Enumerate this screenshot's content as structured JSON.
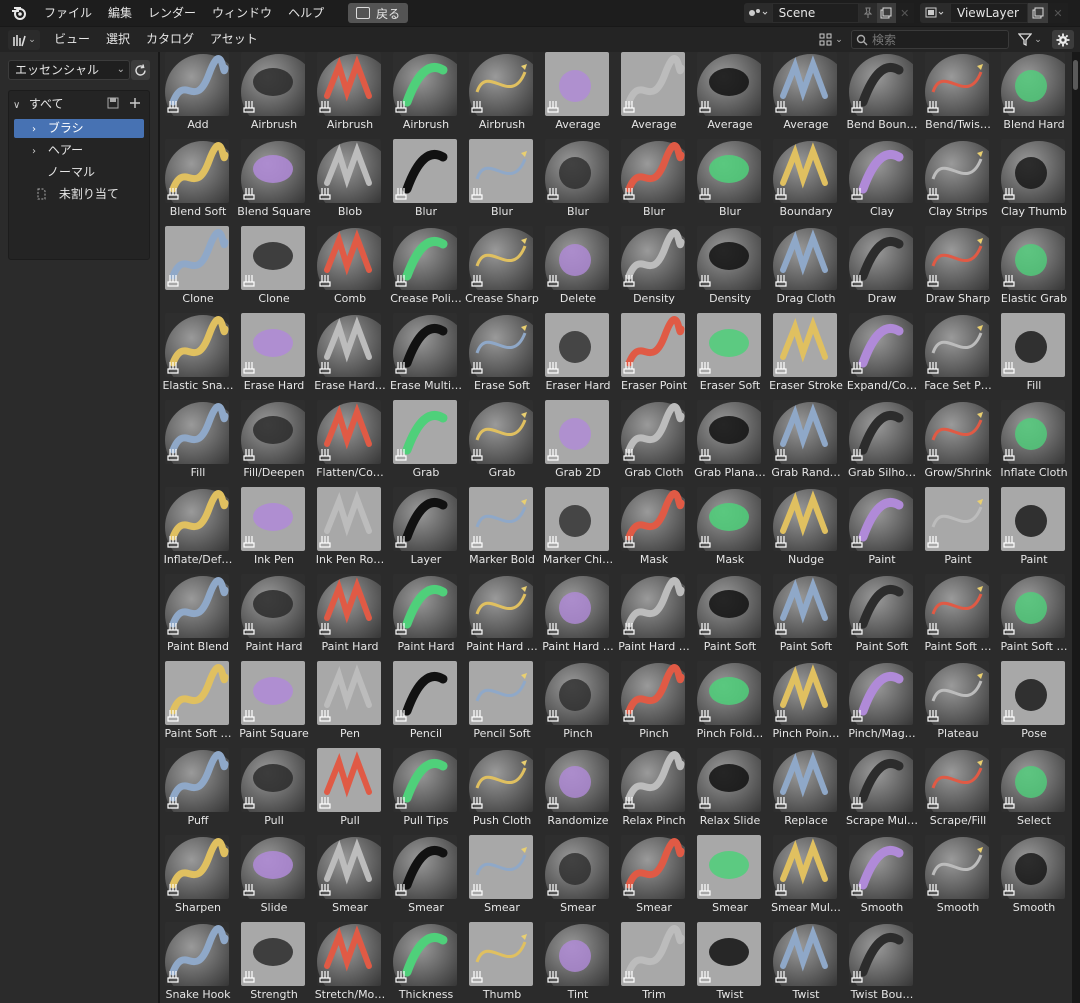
{
  "topbar": {
    "menus": [
      "ファイル",
      "編集",
      "レンダー",
      "ウィンドウ",
      "ヘルプ"
    ],
    "back_label": "戻る",
    "scene_name": "Scene",
    "view_layer": "ViewLayer"
  },
  "header": {
    "menus": [
      "ビュー",
      "選択",
      "カタログ",
      "アセット"
    ],
    "search_placeholder": "検索"
  },
  "sidebar": {
    "library": "エッセンシャル",
    "tree": [
      {
        "label": "すべて"
      },
      {
        "label": "ブラシ"
      },
      {
        "label": "ヘアー"
      },
      {
        "label": "ノーマル"
      },
      {
        "label": "未割り当て"
      }
    ]
  },
  "assets": [
    "Add",
    "Airbrush",
    "Airbrush",
    "Airbrush",
    "Airbrush",
    "Average",
    "Average",
    "Average",
    "Average",
    "Bend Boun…",
    "Bend/Twis…",
    "Blend Hard",
    "Blend Soft",
    "Blend Square",
    "Blob",
    "Blur",
    "Blur",
    "Blur",
    "Blur",
    "Blur",
    "Boundary",
    "Clay",
    "Clay Strips",
    "Clay Thumb",
    "Clone",
    "Clone",
    "Comb",
    "Crease Poli…",
    "Crease Sharp",
    "Delete",
    "Density",
    "Density",
    "Drag Cloth",
    "Draw",
    "Draw Sharp",
    "Elastic Grab",
    "Elastic Sna…",
    "Erase Hard",
    "Erase Hard…",
    "Erase Multi…",
    "Erase Soft",
    "Eraser Hard",
    "Eraser Point",
    "Eraser Soft",
    "Eraser Stroke",
    "Expand/Co…",
    "Face Set P…",
    "Fill",
    "Fill",
    "Fill/Deepen",
    "Flatten/Co…",
    "Grab",
    "Grab",
    "Grab 2D",
    "Grab Cloth",
    "Grab Plana…",
    "Grab Rand…",
    "Grab Silho…",
    "Grow/Shrink",
    "Inflate Cloth",
    "Inflate/Def…",
    "Ink Pen",
    "Ink Pen Ro…",
    "Layer",
    "Marker Bold",
    "Marker Chi…",
    "Mask",
    "Mask",
    "Nudge",
    "Paint",
    "Paint",
    "Paint",
    "Paint Blend",
    "Paint Hard",
    "Paint Hard",
    "Paint Hard",
    "Paint Hard …",
    "Paint Hard …",
    "Paint Hard …",
    "Paint Soft",
    "Paint Soft",
    "Paint Soft",
    "Paint Soft …",
    "Paint Soft …",
    "Paint Soft …",
    "Paint Square",
    "Pen",
    "Pencil",
    "Pencil Soft",
    "Pinch",
    "Pinch",
    "Pinch Fold…",
    "Pinch Poin…",
    "Pinch/Mag…",
    "Plateau",
    "Pose",
    "Puff",
    "Pull",
    "Pull",
    "Pull Tips",
    "Push Cloth",
    "Randomize",
    "Relax Pinch",
    "Relax Slide",
    "Replace",
    "Scrape Mul…",
    "Scrape/Fill",
    "Select",
    "Sharpen",
    "Slide",
    "Smear",
    "Smear",
    "Smear",
    "Smear",
    "Smear",
    "Smear",
    "Smear Mul…",
    "Smooth",
    "Smooth",
    "Smooth",
    "Snake Hook",
    "Strength",
    "Stretch/Mo…",
    "Thickness",
    "Thumb",
    "Tint",
    "Trim",
    "Twist",
    "Twist",
    "Twist Bou…"
  ]
}
